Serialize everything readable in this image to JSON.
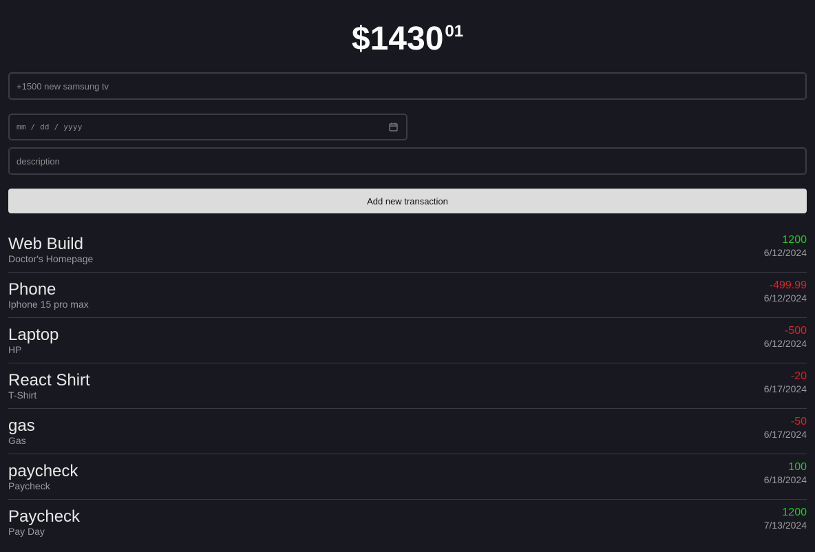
{
  "balance": {
    "dollars": "$1430",
    "cents": "01"
  },
  "form": {
    "name_placeholder": "+1500 new samsung tv",
    "date_placeholder": "mm / dd / yyyy",
    "description_placeholder": "description",
    "submit_label": "Add new transaction",
    "calendar_icon": "calendar-icon"
  },
  "colors": {
    "background": "#181920",
    "positive": "#22c52a",
    "negative": "#e02020",
    "button": "#dcdcdc"
  },
  "transactions": [
    {
      "name": "Web Build",
      "description": "Doctor's Homepage",
      "price": "1200",
      "date": "6/12/2024",
      "sign": "pos"
    },
    {
      "name": "Phone",
      "description": "Iphone 15 pro max",
      "price": "-499.99",
      "date": "6/12/2024",
      "sign": "neg"
    },
    {
      "name": "Laptop",
      "description": "HP",
      "price": "-500",
      "date": "6/12/2024",
      "sign": "neg"
    },
    {
      "name": "React Shirt",
      "description": "T-Shirt",
      "price": "-20",
      "date": "6/17/2024",
      "sign": "neg"
    },
    {
      "name": "gas",
      "description": "Gas",
      "price": "-50",
      "date": "6/17/2024",
      "sign": "neg"
    },
    {
      "name": "paycheck",
      "description": "Paycheck",
      "price": "100",
      "date": "6/18/2024",
      "sign": "pos"
    },
    {
      "name": "Paycheck",
      "description": "Pay Day",
      "price": "1200",
      "date": "7/13/2024",
      "sign": "pos"
    }
  ]
}
